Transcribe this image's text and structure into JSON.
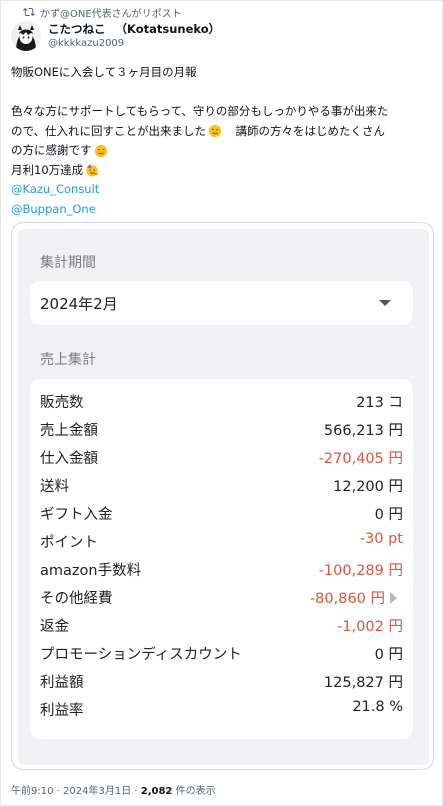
{
  "repost": {
    "text": "かず@ONE代表さんがリポスト",
    "icon": "repost-icon"
  },
  "author": {
    "name": "こたつねこ",
    "name_en": "（Kotatsuneko）",
    "handle": "@kkkkazu2009",
    "avatar": "avatar-illustration"
  },
  "tweet": {
    "line1": "物販ONEに入会して３ヶ月目の月報",
    "line2": "色々な方にサポートしてもらって、守りの部分もしっかりやる事が出来た",
    "line3a": "ので、仕入れに回すことが出来ました",
    "line3b": "　講師の方々をはじめたくさん",
    "line4": "の方に感謝です",
    "line5": "月利10万達成",
    "mention1": "@Kazu_Consult",
    "mention2": "@Buppan_One"
  },
  "media": {
    "period_title": "集計期間",
    "period_value": "2024年2月",
    "sales_title": "売上集計",
    "rows": [
      {
        "label": "販売数",
        "value": "213 コ",
        "negative": false
      },
      {
        "label": "売上金額",
        "value": "566,213 円",
        "negative": false
      },
      {
        "label": "仕入金額",
        "value": "-270,405 円",
        "negative": true
      },
      {
        "label": "送料",
        "value": "12,200 円",
        "negative": false
      },
      {
        "label": "ギフト入金",
        "value": "0 円",
        "negative": false
      },
      {
        "label": "ポイント",
        "value": "-30 pt",
        "negative": true
      },
      {
        "label": "amazon手数料",
        "value": "-100,289 円",
        "negative": true
      },
      {
        "label": "その他経費",
        "value": "-80,860 円",
        "negative": true
      },
      {
        "label": "返金",
        "value": "-1,002 円",
        "negative": true
      },
      {
        "label": "プロモーションディスカウント",
        "value": "0 円",
        "negative": false
      },
      {
        "label": "利益額",
        "value": "125,827 円",
        "negative": false
      },
      {
        "label": "利益率",
        "value": "21.8 %",
        "negative": false
      }
    ]
  },
  "footer": {
    "time": "午前9:10",
    "sep": " · ",
    "date": "2024年3月1日",
    "views_count": "2,082",
    "views_label": " 件の表示"
  },
  "colors": {
    "link": "#1d9bf0",
    "negative": "#e0533b",
    "muted": "#536471"
  }
}
